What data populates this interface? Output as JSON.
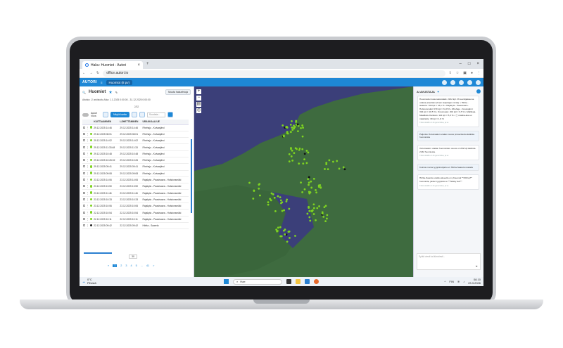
{
  "browser": {
    "tab_title": "Haku: Huomiot - Autori",
    "url": "office.autori.io"
  },
  "app": {
    "logo": "AUTORI",
    "active_tab": "Huomiot (8 pv)"
  },
  "left_panel": {
    "search_title": "Huomiot",
    "saved_searches": "Muuta hakuehtoja",
    "filters": "Arkisto: ☑ arkistoitu   Aika: 1.1.2025 0:00:00 - 31.12.2025 0:00:00",
    "toggle_label": "Autori Viiva",
    "show_button": "Näytä kartta",
    "search_placeholder": "Suodata...",
    "count_label": "2/32",
    "columns": [
      "",
      "",
      "",
      "KUITTAAMINEN",
      "LÄHETTÄMINEN",
      "URAKKA-ALUE"
    ],
    "rows": [
      {
        "status": "green",
        "date1": "29.12.2025 14:46",
        "date2": "29.12.2025 14:46",
        "area": "Rhehaju - Kuivasjärvi"
      },
      {
        "status": "green",
        "date1": "29.12.2025 08:01",
        "date2": "29.12.2025 08:01",
        "area": "Rhehaju - Kuivasjärvi"
      },
      {
        "status": "green",
        "date1": "29.12.2025 14:02",
        "date2": "29.12.2025 14:02",
        "area": "Rhehaju - Kuivasjärvi"
      },
      {
        "status": "green",
        "date1": "29.12.2025 11:33:48",
        "date2": "29.12.2025 11:33",
        "area": "Rhehaju - Kuivasjärvi"
      },
      {
        "status": "green",
        "date1": "29.12.2025 10:48",
        "date2": "29.12.2025 10:48",
        "area": "Rhehaju - Kuivasjärvi"
      },
      {
        "status": "green",
        "date1": "29.12.2025 10:26:02",
        "date2": "29.12.2025 10:26",
        "area": "Rhehaju - Kuivasjärvi"
      },
      {
        "status": "green",
        "date1": "29.12.2025 09:41",
        "date2": "29.12.2025 09:41",
        "area": "Rhehaju - Kuivasjärvi"
      },
      {
        "status": "green",
        "date1": "29.12.2025 09:08",
        "date2": "29.12.2025 09:08",
        "area": "Rhehaju - Kuivasjärvi"
      },
      {
        "status": "green",
        "date1": "23.12.2025 14:06",
        "date2": "23.12.2025 14:06",
        "area": "Rajakyla - Paasivaara - Holstonsmäki"
      },
      {
        "status": "green",
        "date1": "23.12.2025 13:50",
        "date2": "23.12.2025 13:50",
        "area": "Rajakyla - Paasivaara - Holstonsmäki"
      },
      {
        "status": "green",
        "date1": "23.12.2025 11:46",
        "date2": "23.12.2025 11:46",
        "area": "Rajakyla - Paasivaara - Holstonsmäki"
      },
      {
        "status": "green",
        "date1": "23.12.2025 10:33",
        "date2": "23.12.2025 10:33",
        "area": "Rajakyla - Paasivaara - Holstonsmäki"
      },
      {
        "status": "green",
        "date1": "23.12.2025 10:06",
        "date2": "23.12.2025 10:06",
        "area": "Rajakyla - Paasivaara - Holstonsmäki"
      },
      {
        "status": "green",
        "date1": "22.12.2025 10:54",
        "date2": "22.12.2025 10:54",
        "area": "Rajakyla - Paasivaara - Holstonsmäki"
      },
      {
        "status": "green",
        "date1": "22.12.2025 10:11",
        "date2": "22.12.2025 10:11",
        "area": "Rajakyla - Paasivaara - Holstonsmäki"
      },
      {
        "status": "black",
        "date1": "22.12.2025 09:42",
        "date2": "22.12.2025 09:42",
        "area": "Hiirtta - Saarela"
      }
    ],
    "per_page": "30",
    "pages": [
      "1",
      "2",
      "3",
      "4",
      "5",
      "...",
      "41",
      ">"
    ]
  },
  "ai_panel": {
    "title": "AI AVUSTAJA",
    "messages": [
      {
        "type": "answer",
        "text": "Huomioiden kokonaismäärä: 2132 kpl. Prosenttijakauma urakka-alueittain (ilman kuljettajan nimiä): • Hiirtta - Saarela: 706 kpl = 33,1 % • Rajakyla - Paasivaara - Holstonsmäki: 679 kpl = 31,8 % • Rhehaju - Kuivasjärvi: 394 kpl = 18,5 % • Outumaato: 202 kpl = 9,5 % • Mallikuja-Maalikulu-Kankaro: 112 kpl = 5,3 % • ⓘ urakka-alue ei määritelty: 39 kpl = 1,8 %",
        "stamp": "Tämä sisältö on AI-generoitua, ja se"
      },
      {
        "type": "question",
        "text": "Paljonko Outumaalon urakan osuus prosentteina kaikista huomioista"
      },
      {
        "type": "answer",
        "text": "Outumaalon urakan huomioiden osuus on 202 kpl kaikista 2132 huomiosta.",
        "stamp": "Tämä sisältö on AI-generoitua, ja se"
      },
      {
        "type": "question",
        "text": "Kuinka monta tyyppiä kirjattu eri Hiirtta-Saarela urakalle"
      },
      {
        "type": "answer",
        "text": "Hiirtta-Saarela urakka alueella on yhteensä **330 kpl** huomioita, joiden tyyppinä on **Tarkky kuri**",
        "stamp": "Tämä sisältö on AI-generoitua, ja se"
      }
    ],
    "compose_placeholder": "Syötä viesti tai ääniviesti..."
  },
  "taskbar": {
    "temp": "0°C",
    "weather": "Pilvistä",
    "search": "Hae",
    "lang": "FIN",
    "time": "08.10",
    "date": "23.3.2026"
  },
  "colors": {
    "accent": "#1e88d6",
    "map_water": "#3b3f79",
    "map_land": "#3e6b3f",
    "marker_green": "#7ed321"
  }
}
